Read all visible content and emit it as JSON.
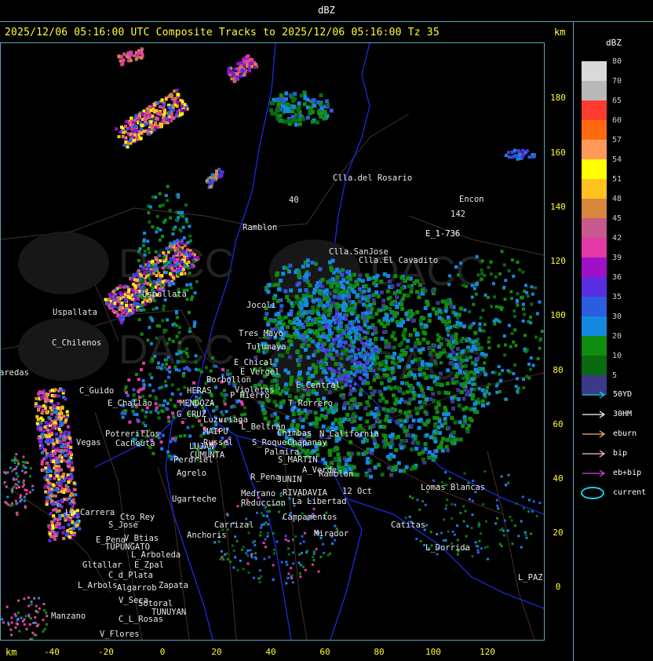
{
  "header": {
    "title": "dBZ"
  },
  "map_header": {
    "headline": "2025/12/06 05:16:00 UTC Composite Tracks to 2025/12/06 05:16:00 Tz 35",
    "km": "km"
  },
  "axes": {
    "x_unit": "km",
    "y_unit": "km",
    "x_ticks": [
      "-40",
      "-20",
      "0",
      "20",
      "40",
      "60",
      "80",
      "100",
      "120"
    ],
    "y_ticks": [
      "180",
      "160",
      "140",
      "120",
      "100",
      "80",
      "60",
      "40",
      "20",
      "0"
    ]
  },
  "legend": {
    "title": "dBZ",
    "levels": [
      {
        "value": "80",
        "color": "#d9d9d9"
      },
      {
        "value": "70",
        "color": "#b8b8b8"
      },
      {
        "value": "65",
        "color": "#ff3b2f"
      },
      {
        "value": "60",
        "color": "#ff6a10"
      },
      {
        "value": "57",
        "color": "#ff9959"
      },
      {
        "value": "54",
        "color": "#ffff00"
      },
      {
        "value": "51",
        "color": "#ffc21f"
      },
      {
        "value": "48",
        "color": "#d7863c"
      },
      {
        "value": "45",
        "color": "#c8588e"
      },
      {
        "value": "42",
        "color": "#e13aa6"
      },
      {
        "value": "39",
        "color": "#9f10c8"
      },
      {
        "value": "36",
        "color": "#5a2ee0"
      },
      {
        "value": "35",
        "color": "#2a5de0"
      },
      {
        "value": "30",
        "color": "#138ae0"
      },
      {
        "value": "20",
        "color": "#108c10"
      },
      {
        "value": "10",
        "color": "#0a6a10"
      },
      {
        "value": "5",
        "color": "#3a3a8a"
      }
    ],
    "tracks": [
      {
        "label": "50YD",
        "color": "#17d1e8"
      },
      {
        "label": "30HM",
        "color": "#ffffff"
      },
      {
        "label": "eburn",
        "color": "#f4b860"
      },
      {
        "label": "bip",
        "color": "#ffc0c0"
      },
      {
        "label": "eb+bip",
        "color": "#e040e0"
      }
    ],
    "current_label": "current"
  },
  "map": {
    "watermark": "DACC",
    "places": [
      "Clla.del Rosario",
      "Encon",
      "Ramblon",
      "E_1-736",
      "Clla.SanJose",
      "Clla.El Cavadito",
      "Uspallata",
      "Uspallata",
      "C_Chilenos",
      "aredas",
      "Tres_Mayo",
      "Tulumaya",
      "Jocoli",
      "E_Chical",
      "E_Vergel",
      "Borbollon",
      "Violetas",
      "E_Central",
      "P_Hierro",
      "T_Rorrero",
      "C_Guido",
      "E_Challao",
      "HERAS",
      "MENDOZA",
      "G_CRUZ",
      "Luzuriaga",
      "L_Beltran",
      "Chimbas",
      "Chapanay",
      "N_California",
      "Potrerillos",
      "Cacheuta",
      "Vegas",
      "MAIPU",
      "Russel",
      "LUJAN",
      "CUMUNTA",
      "Perdriel",
      "S_Roque",
      "Palmira",
      "S_MARTIN",
      "Agrelo",
      "R_Pena",
      "JUNIN",
      "A_Verde",
      "Ramblon",
      "Ugarteche",
      "Medrano",
      "Reduccion",
      "RIVADAVIA",
      "12 Oct",
      "La Libertad",
      "Lomas Blancas",
      "La_Carrera",
      "Cto_Rey",
      "S_Jose",
      "Carrizal",
      "Campamentos",
      "Catitas",
      "E_Pena",
      "TUPUNGATO",
      "V_Btias",
      "Anchoris",
      "Mirador",
      "L_Dorrida",
      "L_Arboleda",
      "Gltallar",
      "E_Zpal",
      "C_d_Plata",
      "L_Arbols",
      "Algarrob",
      "Zapata",
      "V_Seca",
      "Sotoral",
      "TUNUYAN",
      "Manzano",
      "C_L_Rosas",
      "V_Flores",
      "L_PAZ",
      "142",
      "40",
      "E_1-736"
    ]
  }
}
